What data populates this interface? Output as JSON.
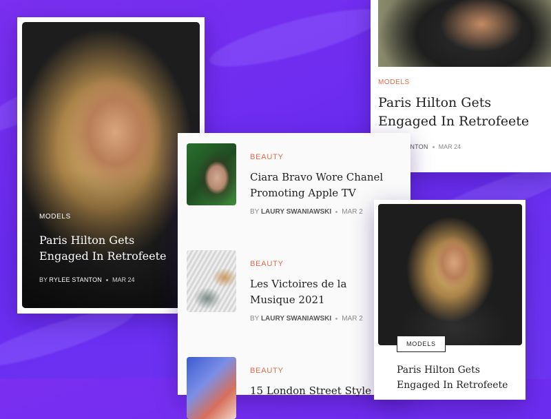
{
  "featured_card": {
    "category": "MODELS",
    "title": "Paris Hilton Gets Engaged In Retrofeete",
    "by": "BY",
    "author": "RYLEE STANTON",
    "date": "MAR 24"
  },
  "top_card": {
    "category": "MODELS",
    "title": "Paris Hilton Gets Engaged In Retrofeete",
    "author": "STANTON",
    "date": "MAR 24"
  },
  "list_card": {
    "items": [
      {
        "category": "BEAUTY",
        "title_line1": "Ciara Bravo Wore Chanel",
        "title_line2": "Promoting Apple TV",
        "by": "BY",
        "author": "LAURY SWANIAWSKI",
        "date": "MAR 2"
      },
      {
        "category": "BEAUTY",
        "title_line1": "Les Victoires de la",
        "title_line2": "Musique 2021",
        "by": "BY",
        "author": "LAURY SWANIAWSKI",
        "date": "MAR 2"
      },
      {
        "category": "BEAUTY",
        "title_line1": "15 London Street Style",
        "title_line2": "",
        "by": "",
        "author": "",
        "date": ""
      }
    ]
  },
  "bottom_card": {
    "badge": "MODELS",
    "title": "Paris Hilton Gets Engaged In Retrofeete"
  },
  "colors": {
    "accent": "#e0694b",
    "background": "#6f2ff0"
  }
}
